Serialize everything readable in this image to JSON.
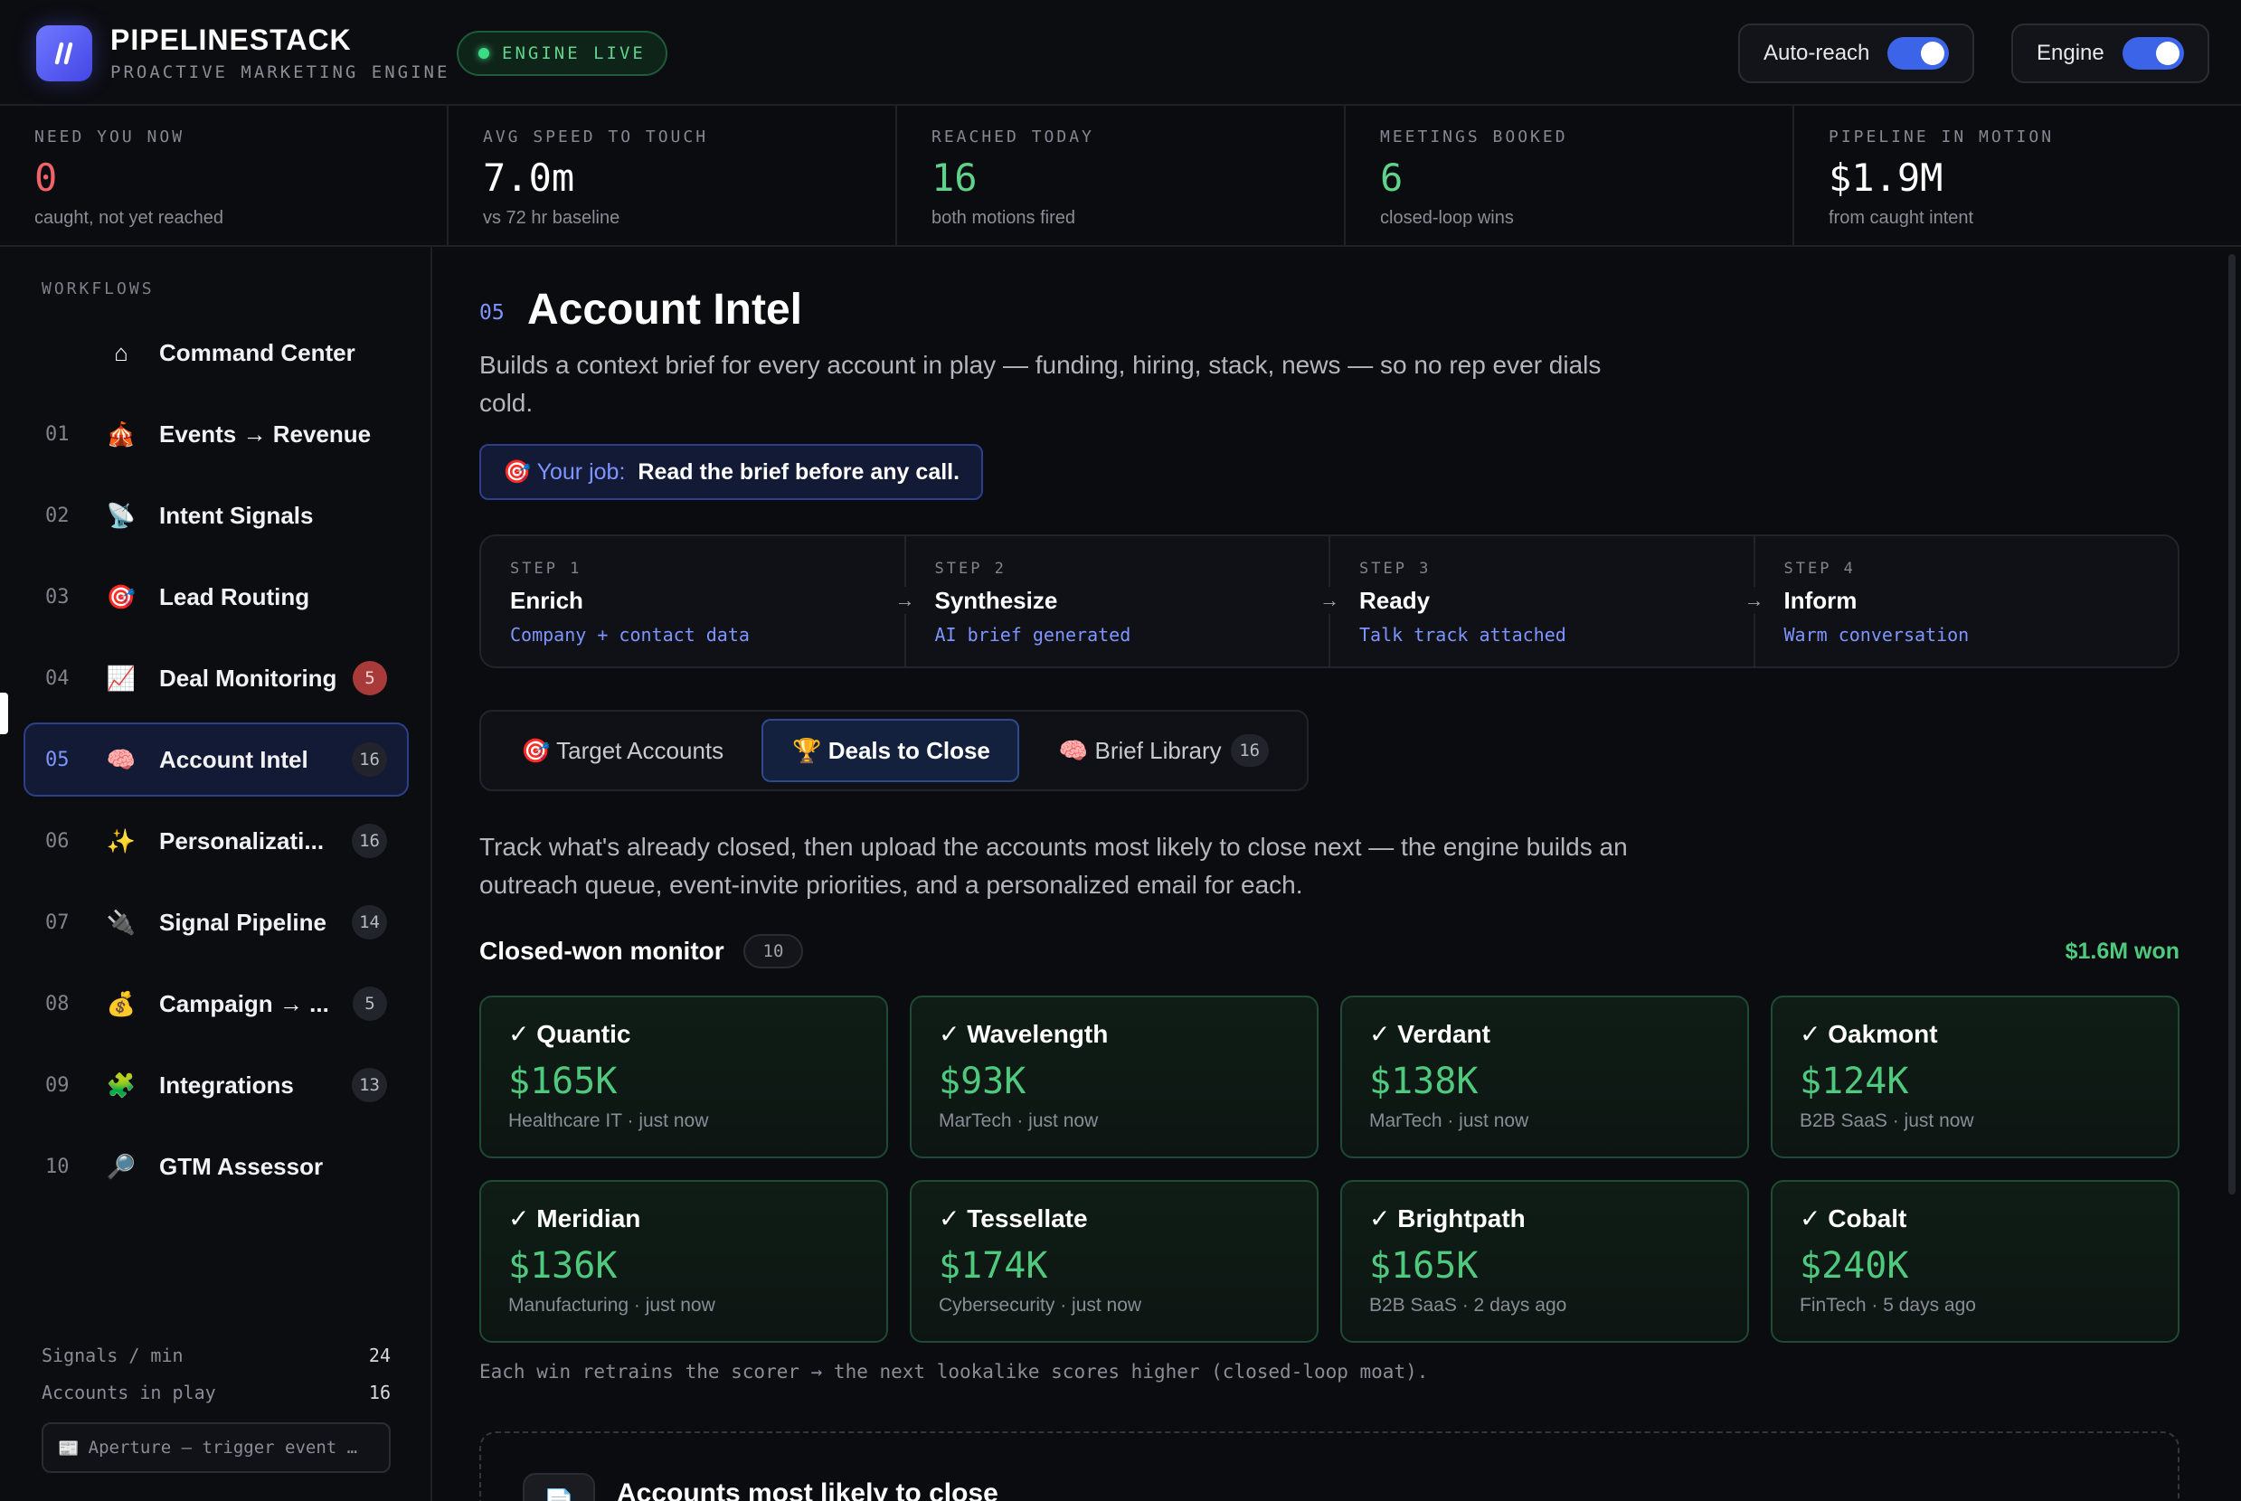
{
  "header": {
    "brand_name": "PIPELINESTACK",
    "brand_sub": "PROACTIVE MARKETING ENGINE",
    "engine_status": "ENGINE LIVE",
    "toggles": [
      {
        "label": "Auto-reach",
        "on": true
      },
      {
        "label": "Engine",
        "on": true
      }
    ]
  },
  "stats": [
    {
      "label": "NEED YOU NOW",
      "value": "0",
      "sub": "caught, not yet reached",
      "color": "#f0636b"
    },
    {
      "label": "AVG SPEED TO TOUCH",
      "value": "7.0m",
      "sub": "vs 72 hr baseline",
      "color": "#ffffff"
    },
    {
      "label": "REACHED TODAY",
      "value": "16",
      "sub": "both motions fired",
      "color": "#5fd38b"
    },
    {
      "label": "MEETINGS BOOKED",
      "value": "6",
      "sub": "closed-loop wins",
      "color": "#5fd38b"
    },
    {
      "label": "PIPELINE IN MOTION",
      "value": "$1.9M",
      "sub": "from caught intent",
      "color": "#ffffff"
    }
  ],
  "sidebar": {
    "heading": "WORKFLOWS",
    "items": [
      {
        "num": "",
        "icon": "⌂",
        "icon_name": "home-icon",
        "label": "Command Center",
        "badge": ""
      },
      {
        "num": "01",
        "icon": "🎪",
        "icon_name": "circus-tent-icon",
        "label": "Events → Revenue",
        "badge": ""
      },
      {
        "num": "02",
        "icon": "📡",
        "icon_name": "satellite-dish-icon",
        "label": "Intent Signals",
        "badge": ""
      },
      {
        "num": "03",
        "icon": "🎯",
        "icon_name": "target-icon",
        "label": "Lead Routing",
        "badge": ""
      },
      {
        "num": "04",
        "icon": "📈",
        "icon_name": "chart-up-icon",
        "label": "Deal Monitoring",
        "badge": "5",
        "badge_alert": true
      },
      {
        "num": "05",
        "icon": "🧠",
        "icon_name": "brain-icon",
        "label": "Account Intel",
        "badge": "16",
        "active": true
      },
      {
        "num": "06",
        "icon": "✨",
        "icon_name": "sparkles-icon",
        "label": "Personalizati...",
        "badge": "16"
      },
      {
        "num": "07",
        "icon": "🔌",
        "icon_name": "plug-icon",
        "label": "Signal Pipeline",
        "badge": "14"
      },
      {
        "num": "08",
        "icon": "💰",
        "icon_name": "money-bag-icon",
        "label": "Campaign → ...",
        "badge": "5"
      },
      {
        "num": "09",
        "icon": "🧩",
        "icon_name": "puzzle-icon",
        "label": "Integrations",
        "badge": "13"
      },
      {
        "num": "10",
        "icon": "🔎",
        "icon_name": "magnifier-icon",
        "label": "GTM Assessor",
        "badge": ""
      }
    ],
    "meta": [
      {
        "label": "Signals / min",
        "value": "24"
      },
      {
        "label": "Accounts in play",
        "value": "16"
      }
    ],
    "ticker": "Aperture — trigger event …"
  },
  "section": {
    "num": "05",
    "title": "Account Intel",
    "description": "Builds a context brief for every account in play — funding, hiring, stack, news — so no rep ever dials cold.",
    "job_label": "🎯 Your job:",
    "job_value": "Read the brief before any call."
  },
  "steps": [
    {
      "label": "STEP 1",
      "title": "Enrich",
      "sub": "Company + contact data"
    },
    {
      "label": "STEP 2",
      "title": "Synthesize",
      "sub": "AI brief generated"
    },
    {
      "label": "STEP 3",
      "title": "Ready",
      "sub": "Talk track attached"
    },
    {
      "label": "STEP 4",
      "title": "Inform",
      "sub": "Warm conversation"
    }
  ],
  "tabs": [
    {
      "label": "🎯 Target Accounts",
      "badge": ""
    },
    {
      "label": "🏆 Deals to Close",
      "badge": "",
      "active": true
    },
    {
      "label": "🧠 Brief Library",
      "badge": "16"
    }
  ],
  "body_desc": "Track what's already closed, then upload the accounts most likely to close next — the engine builds an outreach queue, event-invite priorities, and a personalized email for each.",
  "monitor": {
    "title": "Closed-won monitor",
    "count": "10",
    "won": "$1.6M won",
    "cards": [
      {
        "name": "✓ Quantic",
        "value": "$165K",
        "meta": "Healthcare IT · just now"
      },
      {
        "name": "✓ Wavelength",
        "value": "$93K",
        "meta": "MarTech · just now"
      },
      {
        "name": "✓ Verdant",
        "value": "$138K",
        "meta": "MarTech · just now"
      },
      {
        "name": "✓ Oakmont",
        "value": "$124K",
        "meta": "B2B SaaS · just now"
      },
      {
        "name": "✓ Meridian",
        "value": "$136K",
        "meta": "Manufacturing · just now"
      },
      {
        "name": "✓ Tessellate",
        "value": "$174K",
        "meta": "Cybersecurity · just now"
      },
      {
        "name": "✓ Brightpath",
        "value": "$165K",
        "meta": "B2B SaaS · 2 days ago"
      },
      {
        "name": "✓ Cobalt",
        "value": "$240K",
        "meta": "FinTech · 5 days ago"
      }
    ],
    "footnote": "Each win retrains the scorer → the next lookalike scores higher (closed-loop moat)."
  },
  "likely": {
    "title": "Accounts most likely to close"
  }
}
